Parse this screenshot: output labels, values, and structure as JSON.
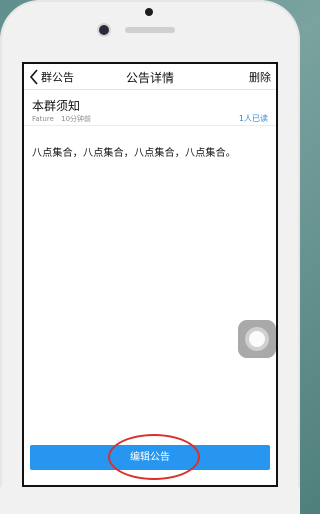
{
  "navbar": {
    "back_label": "群公告",
    "title": "公告详情",
    "delete_label": "删除"
  },
  "notice": {
    "title": "本群须知",
    "author": "Fature",
    "time": "10分钟前",
    "read_count": "1人已读",
    "content": "八点集合，八点集合，八点集合，八点集合。"
  },
  "footer": {
    "edit_label": "编辑公告"
  },
  "colors": {
    "accent": "#2796f1",
    "highlight": "#d9302a"
  }
}
